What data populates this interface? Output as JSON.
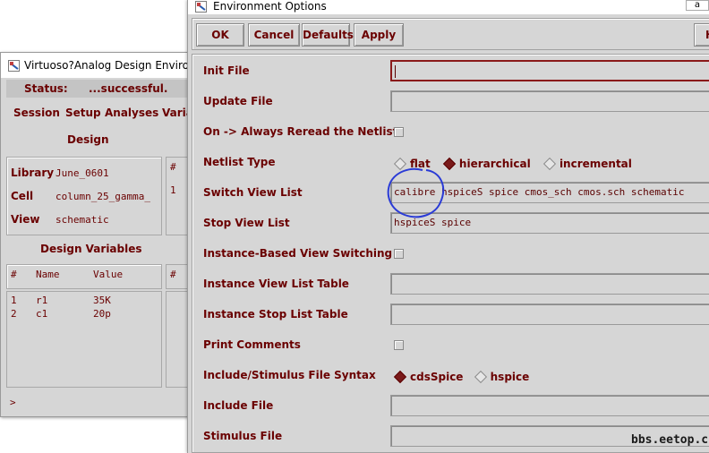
{
  "background_window": {
    "title": "Virtuoso?Analog Design Environ",
    "status_label": "Status:",
    "status_value": "...successful.",
    "menus": [
      "Session",
      "Setup",
      "Analyses",
      "Varia"
    ],
    "design_header": "Design",
    "library_label": "Library",
    "library_value": "June_0601",
    "cell_label": "Cell",
    "cell_value": "column_25_gamma_",
    "view_label": "View",
    "view_value": "schematic",
    "side_hash_1": "#",
    "side_one": "1",
    "design_variables_header": "Design Variables",
    "vars_columns": [
      "#",
      "Name",
      "Value"
    ],
    "vars_rows": [
      {
        "n": "1",
        "name": "r1",
        "value": "35K"
      },
      {
        "n": "2",
        "name": "c1",
        "value": "20p"
      }
    ],
    "side_hash_2": "#",
    "prompt": ">"
  },
  "main_window": {
    "title": "Environment Options",
    "corner_text": "a",
    "buttons": {
      "ok": "OK",
      "cancel": "Cancel",
      "defaults": "Defaults",
      "apply": "Apply",
      "help": "H"
    },
    "init_file_label": "Init File",
    "init_file_value": "",
    "update_file_label": "Update File",
    "update_file_value": "",
    "always_reread_label": "On -> Always Reread the Netlist",
    "netlist_type_label": "Netlist Type",
    "netlist_type_options": [
      "flat",
      "hierarchical",
      "incremental"
    ],
    "netlist_type_selected": "hierarchical",
    "switch_view_list_label": "Switch View List",
    "switch_view_list_value": "calibre hspiceS spice cmos_sch cmos.sch schematic",
    "stop_view_list_label": "Stop View List",
    "stop_view_list_value": "hspiceS spice",
    "instance_based_label": "Instance-Based View Switching",
    "instance_view_table_label": "Instance View List Table",
    "instance_view_table_value": "",
    "instance_stop_table_label": "Instance Stop List Table",
    "instance_stop_table_value": "",
    "print_comments_label": "Print Comments",
    "stimulus_syntax_label": "Include/Stimulus File Syntax",
    "stimulus_syntax_options": [
      "cdsSpice",
      "hspice"
    ],
    "stimulus_syntax_selected": "cdsSpice",
    "include_file_label": "Include File",
    "include_file_value": "",
    "stimulus_file_label": "Stimulus File",
    "stimulus_file_value": ""
  },
  "watermark": "bbs.eetop.cn",
  "colors": {
    "label": "#6a0000",
    "panel": "#d6d6d6",
    "annotation": "#2a3bd6",
    "focus_border": "#8a1a1a"
  }
}
